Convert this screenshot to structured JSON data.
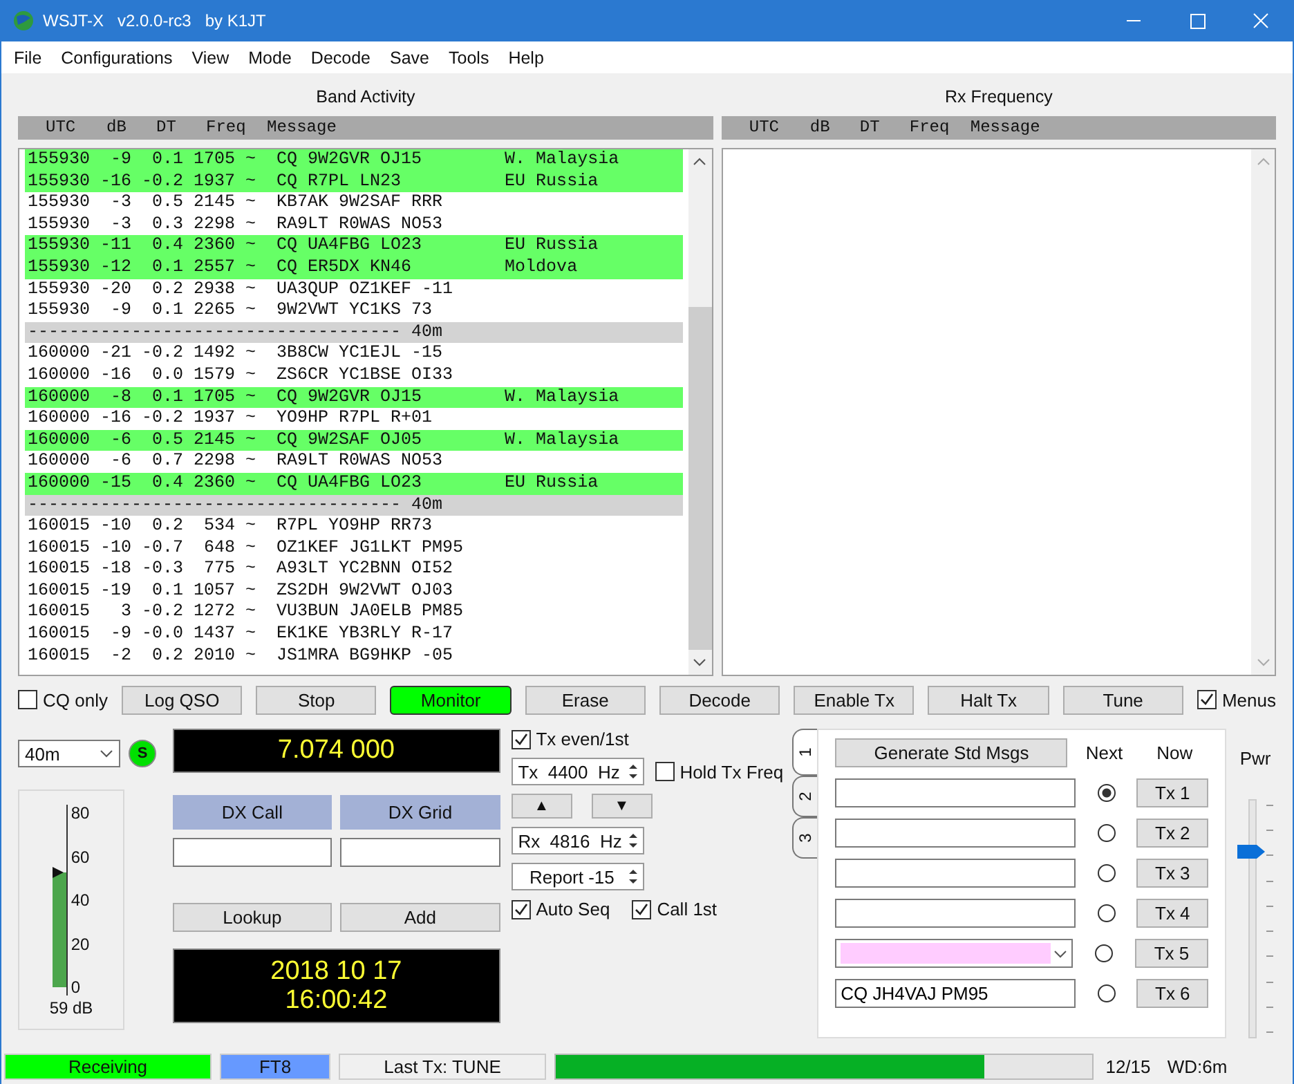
{
  "window": {
    "title": "WSJT-X   v2.0.0-rc3   by K1JT"
  },
  "menu": [
    "File",
    "Configurations",
    "View",
    "Mode",
    "Decode",
    "Save",
    "Tools",
    "Help"
  ],
  "band_activity": {
    "title": "Band Activity",
    "columns": [
      "UTC",
      "dB",
      "DT",
      "Freq",
      "Message"
    ],
    "rows": [
      {
        "kind": "decode",
        "highlight": true,
        "text": "155930  -9  0.1 1705 ~  CQ 9W2GVR OJ15        W. Malaysia"
      },
      {
        "kind": "decode",
        "highlight": true,
        "text": "155930 -16 -0.2 1937 ~  CQ R7PL LN23          EU Russia"
      },
      {
        "kind": "decode",
        "highlight": false,
        "text": "155930  -3  0.5 2145 ~  KB7AK 9W2SAF RRR"
      },
      {
        "kind": "decode",
        "highlight": false,
        "text": "155930  -3  0.3 2298 ~  RA9LT R0WAS NO53"
      },
      {
        "kind": "decode",
        "highlight": true,
        "text": "155930 -11  0.4 2360 ~  CQ UA4FBG LO23        EU Russia"
      },
      {
        "kind": "decode",
        "highlight": true,
        "text": "155930 -12  0.1 2557 ~  CQ ER5DX KN46         Moldova"
      },
      {
        "kind": "decode",
        "highlight": false,
        "text": "155930 -20  0.2 2938 ~  UA3QUP OZ1KEF -11"
      },
      {
        "kind": "decode",
        "highlight": false,
        "text": "155930  -9  0.1 2265 ~  9W2VWT YC1KS 73"
      },
      {
        "kind": "separator",
        "text": "------------------------------------ 40m"
      },
      {
        "kind": "decode",
        "highlight": false,
        "text": "160000 -21 -0.2 1492 ~  3B8CW YC1EJL -15"
      },
      {
        "kind": "decode",
        "highlight": false,
        "text": "160000 -16  0.0 1579 ~  ZS6CR YC1BSE OI33"
      },
      {
        "kind": "decode",
        "highlight": true,
        "text": "160000  -8  0.1 1705 ~  CQ 9W2GVR OJ15        W. Malaysia"
      },
      {
        "kind": "decode",
        "highlight": false,
        "text": "160000 -16 -0.2 1937 ~  YO9HP R7PL R+01"
      },
      {
        "kind": "decode",
        "highlight": true,
        "text": "160000  -6  0.5 2145 ~  CQ 9W2SAF OJ05        W. Malaysia"
      },
      {
        "kind": "decode",
        "highlight": false,
        "text": "160000  -6  0.7 2298 ~  RA9LT R0WAS NO53"
      },
      {
        "kind": "decode",
        "highlight": true,
        "text": "160000 -15  0.4 2360 ~  CQ UA4FBG LO23        EU Russia"
      },
      {
        "kind": "separator",
        "text": "------------------------------------ 40m"
      },
      {
        "kind": "decode",
        "highlight": false,
        "text": "160015 -10  0.2  534 ~  R7PL YO9HP RR73"
      },
      {
        "kind": "decode",
        "highlight": false,
        "text": "160015 -10 -0.7  648 ~  OZ1KEF JG1LKT PM95"
      },
      {
        "kind": "decode",
        "highlight": false,
        "text": "160015 -18 -0.3  775 ~  A93LT YC2BNN OI52"
      },
      {
        "kind": "decode",
        "highlight": false,
        "text": "160015 -19  0.1 1057 ~  ZS2DH 9W2VWT OJ03"
      },
      {
        "kind": "decode",
        "highlight": false,
        "text": "160015   3 -0.2 1272 ~  VU3BUN JA0ELB PM85"
      },
      {
        "kind": "decode",
        "highlight": false,
        "text": "160015  -9 -0.0 1437 ~  EK1KE YB3RLY R-17"
      },
      {
        "kind": "decode",
        "highlight": false,
        "text": "160015  -2  0.2 2010 ~  JS1MRA BG9HKP -05"
      }
    ]
  },
  "rx_frequency": {
    "title": "Rx Frequency",
    "columns": [
      "UTC",
      "dB",
      "DT",
      "Freq",
      "Message"
    ]
  },
  "controls": [
    {
      "kind": "checkbox",
      "label": "CQ only",
      "checked": false
    },
    {
      "kind": "button",
      "label": "Log QSO",
      "on": false
    },
    {
      "kind": "button",
      "label": "Stop",
      "on": false
    },
    {
      "kind": "button",
      "label": "Monitor",
      "on": true
    },
    {
      "kind": "button",
      "label": "Erase",
      "on": false
    },
    {
      "kind": "button",
      "label": "Decode",
      "on": false
    },
    {
      "kind": "button",
      "label": "Enable Tx",
      "on": false
    },
    {
      "kind": "button",
      "label": "Halt Tx",
      "on": false
    },
    {
      "kind": "button",
      "label": "Tune",
      "on": false
    },
    {
      "kind": "checkbox",
      "label": "Menus",
      "checked": true
    }
  ],
  "band": {
    "value": "40m",
    "s_button": "S"
  },
  "meter": {
    "ticks": [
      "80",
      "60",
      "40",
      "20",
      "0"
    ],
    "level": 0.66,
    "reading": "59 dB"
  },
  "frequency": "7.074 000",
  "dx": {
    "call_label": "DX Call",
    "grid_label": "DX Grid",
    "lookup": "Lookup",
    "add": "Add"
  },
  "clock": {
    "date": "2018 10 17",
    "time": "16:00:42"
  },
  "tx_options": {
    "tx_even": {
      "label": "Tx even/1st",
      "checked": true
    },
    "tx_freq": "Tx  4400  Hz",
    "hold_tx_freq": {
      "label": "Hold Tx Freq",
      "checked": false
    },
    "up": "▲",
    "down": "▼",
    "rx_freq": "Rx  4816  Hz",
    "report": "Report -15",
    "auto_seq": {
      "label": "Auto Seq",
      "checked": true
    },
    "call_1st": {
      "label": "Call 1st",
      "checked": true
    }
  },
  "tabs": [
    {
      "label": "1",
      "selected": true
    },
    {
      "label": "2",
      "selected": false
    },
    {
      "label": "3",
      "selected": false
    }
  ],
  "messages": {
    "generate": "Generate Std Msgs",
    "next": "Next",
    "now": "Now",
    "rows": [
      {
        "kind": "text",
        "selected": true,
        "button": "Tx 1"
      },
      {
        "kind": "text",
        "selected": false,
        "button": "Tx 2"
      },
      {
        "kind": "text",
        "selected": false,
        "button": "Tx 3"
      },
      {
        "kind": "text",
        "selected": false,
        "button": "Tx 4"
      },
      {
        "kind": "combo",
        "selected": false,
        "button": "Tx 5"
      },
      {
        "kind": "text",
        "selected": false,
        "button": "Tx 6",
        "value": "CQ JH4VAJ PM95"
      }
    ]
  },
  "power": {
    "label": "Pwr",
    "level": 0.78
  },
  "status_bar": {
    "state": "Receiving",
    "mode": "FT8",
    "last_tx": "Last Tx: TUNE",
    "level": 0.8,
    "count": "12/15",
    "wd": "WD:6m"
  }
}
